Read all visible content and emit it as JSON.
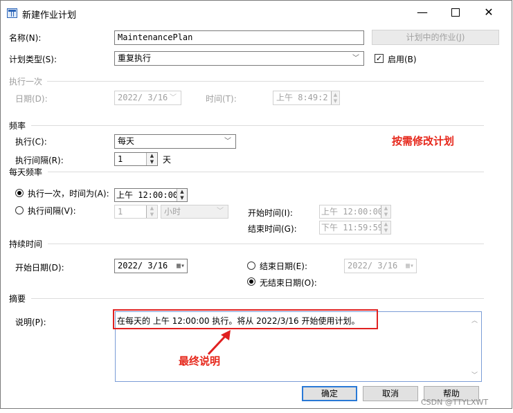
{
  "window": {
    "title": "新建作业计划"
  },
  "titlebar": {
    "minimize": "—",
    "close": "✕"
  },
  "name": {
    "label": "名称(N):",
    "value": "MaintenancePlan",
    "jobs_button": "计划中的作业(J)"
  },
  "schedule_type": {
    "label": "计划类型(S):",
    "value": "重复执行",
    "enabled_label": "启用(B)",
    "enabled_check": "✓",
    "enabled": true
  },
  "once": {
    "group": "执行一次",
    "date_label": "日期(D):",
    "date_value": "2022/ 3/16",
    "time_label": "时间(T):",
    "time_value": "上午  8:49:2"
  },
  "frequency": {
    "group": "频率",
    "occurs_label": "执行(C):",
    "occurs_value": "每天",
    "interval_label": "执行间隔(R):",
    "interval_value": "1",
    "interval_unit": "天"
  },
  "daily": {
    "group": "每天频率",
    "once_label": "执行一次，时间为(A):",
    "once_time": "上午 12:00:00",
    "once_checked": true,
    "every_label": "执行间隔(V):",
    "every_value": "1",
    "every_unit": "小时",
    "start_label": "开始时间(I):",
    "start_value": "上午 12:00:00",
    "end_label": "结束时间(G):",
    "end_value": "下午 11:59:59"
  },
  "duration": {
    "group": "持续时间",
    "start_label": "开始日期(D):",
    "start_value": "2022/ 3/16",
    "end_label": "结束日期(E):",
    "end_value": "2022/ 3/16",
    "no_end_label": "无结束日期(O):",
    "no_end_checked": true
  },
  "summary": {
    "group": "摘要",
    "desc_label": "说明(P):",
    "desc_value": "在每天的 上午 12:00:00 执行。将从 2022/3/16 开始使用计划。"
  },
  "annotations": {
    "modify_note": "按需修改计划",
    "final_note": "最终说明"
  },
  "buttons": {
    "ok": "确定",
    "cancel": "取消",
    "help": "帮助"
  },
  "watermark": "CSDN @TTYLXWT",
  "colors": {
    "annotation_red": "#e6271b",
    "focus_blue": "#2979d6"
  }
}
